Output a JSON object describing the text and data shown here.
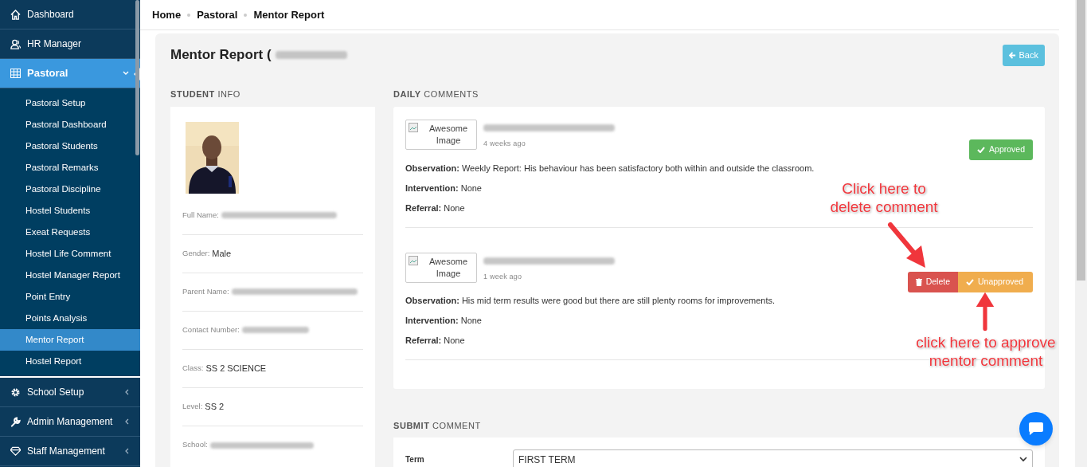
{
  "sidebar": {
    "items": [
      {
        "label": "Dashboard",
        "expanded": false,
        "has_caret": false
      },
      {
        "label": "HR Manager",
        "expanded": false,
        "has_caret": false
      },
      {
        "label": "Pastoral",
        "expanded": true,
        "has_caret": true,
        "children": [
          {
            "label": "Pastoral Setup",
            "selected": false
          },
          {
            "label": "Pastoral Dashboard",
            "selected": false
          },
          {
            "label": "Pastoral Students",
            "selected": false
          },
          {
            "label": "Pastoral Remarks",
            "selected": false
          },
          {
            "label": "Pastoral Discipline",
            "selected": false
          },
          {
            "label": "Hostel Students",
            "selected": false
          },
          {
            "label": "Exeat Requests",
            "selected": false
          },
          {
            "label": "Hostel Life Comment",
            "selected": false
          },
          {
            "label": "Hostel Manager Report",
            "selected": false
          },
          {
            "label": "Point Entry",
            "selected": false
          },
          {
            "label": "Points Analysis",
            "selected": false
          },
          {
            "label": "Mentor Report",
            "selected": true
          },
          {
            "label": "Hostel Report",
            "selected": false
          }
        ]
      },
      {
        "label": "School Setup",
        "expanded": false,
        "has_caret": true
      },
      {
        "label": "Admin Management",
        "expanded": false,
        "has_caret": true
      },
      {
        "label": "Staff Management",
        "expanded": false,
        "has_caret": true
      }
    ]
  },
  "breadcrumb": [
    "Home",
    "Pastoral",
    "Mentor Report"
  ],
  "page": {
    "title": "Mentor Report (",
    "title_redacted": true,
    "back_button": "Back"
  },
  "student_info": {
    "heading": "**STUDENT** INFO",
    "fields": [
      {
        "label": "Full Name:",
        "redacted": true
      },
      {
        "label": "Gender:",
        "redacted": false,
        "value": "Male"
      },
      {
        "label": "Parent Name:",
        "redacted": true
      },
      {
        "label": "Contact Number:",
        "redacted": true
      },
      {
        "label": "Class:",
        "redacted": false,
        "value": "SS 2 SCIENCE"
      },
      {
        "label": "Level:",
        "redacted": false,
        "value": "SS 2"
      },
      {
        "label": "School:",
        "redacted": true
      }
    ]
  },
  "daily_comments": {
    "heading": "**DAILY** COMMENTS",
    "comments": [
      {
        "image_alt": "Awesome Image",
        "author_redacted": true,
        "time": "4 weeks ago",
        "approved": true,
        "status_button": "Approved",
        "observation": "**Observation:** Weekly Report: His behaviour has been satisfactory both within and outside the classroom.",
        "intervention": "**Intervention:** None",
        "referral": "**Referral:** None"
      },
      {
        "image_alt": "Awesome Image",
        "author_redacted": true,
        "time": "1 week ago",
        "approved": false,
        "status_button": "Unapproved",
        "delete_button": "Delete",
        "observation": "**Observation:** His mid term results were good but there are still plenty rooms for improvements.",
        "intervention": "**Intervention:** None",
        "referral": "**Referral:** None"
      }
    ]
  },
  "submit_comment": {
    "heading": "**SUBMIT** COMMENT",
    "term_label": "Term",
    "term_value": "FIRST TERM"
  },
  "annotations": [
    "Click here to delete comment",
    "click here to approve mentor comment"
  ]
}
